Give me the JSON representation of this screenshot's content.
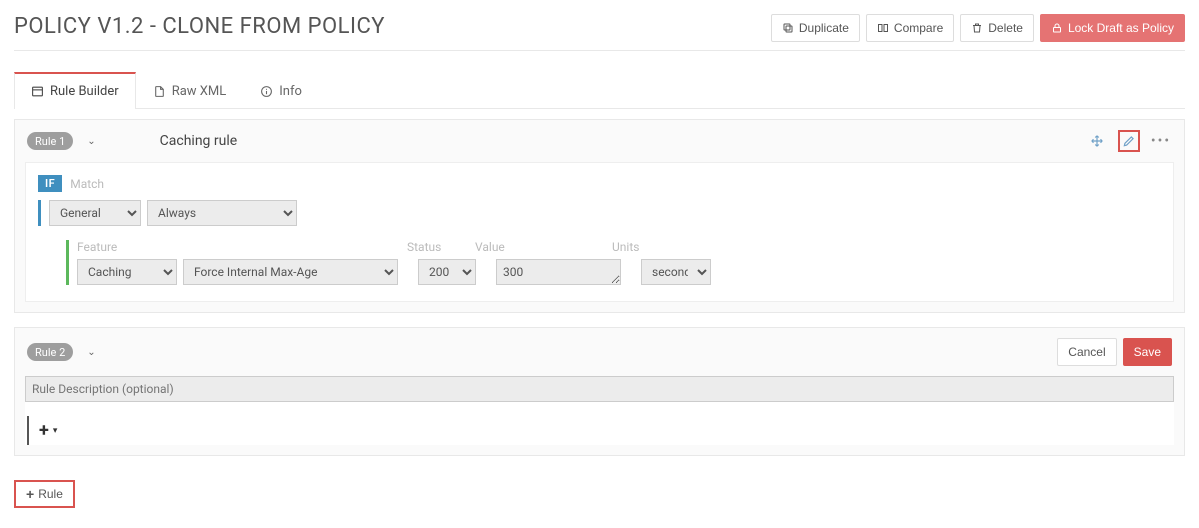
{
  "header": {
    "title": "POLICY V1.2 - CLONE FROM POLICY",
    "buttons": {
      "duplicate": "Duplicate",
      "compare": "Compare",
      "delete": "Delete",
      "lock": "Lock Draft as Policy"
    }
  },
  "tabs": {
    "builder": "Rule Builder",
    "rawxml": "Raw XML",
    "info": "Info"
  },
  "rule1": {
    "badge": "Rule 1",
    "name": "Caching rule",
    "if_label": "IF",
    "match_label": "Match",
    "match_category": "General",
    "match_type": "Always",
    "feature_label": "Feature",
    "status_label": "Status",
    "value_label": "Value",
    "units_label": "Units",
    "feature_category": "Caching",
    "feature_name": "Force Internal Max-Age",
    "status": "200",
    "value": "300",
    "units": "seconds"
  },
  "rule2": {
    "badge": "Rule 2",
    "cancel": "Cancel",
    "save": "Save",
    "desc_placeholder": "Rule Description (optional)"
  },
  "add_rule": "Rule"
}
